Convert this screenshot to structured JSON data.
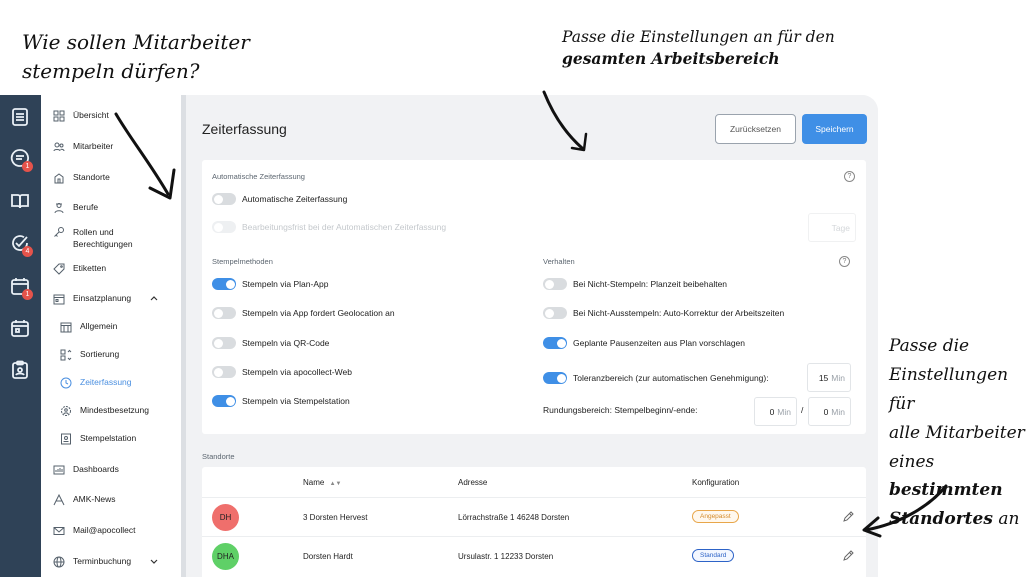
{
  "annotations": {
    "left_line1": "Wie sollen Mitarbeiter",
    "left_line2": "stempeln dürfen?",
    "top_line1": "Passe die Einstellungen an für den",
    "top_line2": "gesamten Arbeitsbereich",
    "right_line1": "Passe die",
    "right_line2": "Einstellungen für",
    "right_line3": "alle Mitarbeiter",
    "right_line4_a": "eines ",
    "right_line4_b": "bestimmten",
    "right_line5_a": "Standortes",
    "right_line5_b": " an"
  },
  "rail": {
    "badges": [
      "1",
      "4",
      "1"
    ]
  },
  "sidebar": {
    "items": [
      {
        "label": "Übersicht",
        "icon": "grid-icon"
      },
      {
        "label": "Mitarbeiter",
        "icon": "users-icon"
      },
      {
        "label": "Standorte",
        "icon": "house-icon"
      },
      {
        "label": "Berufe",
        "icon": "worker-icon"
      },
      {
        "label": "Rollen und\nBerechtigungen",
        "icon": "key-icon"
      },
      {
        "label": "Etiketten",
        "icon": "tag-icon"
      },
      {
        "label": "Einsatzplanung",
        "icon": "calendar-icon"
      },
      {
        "label": "Allgemein",
        "icon": "calendar-grid-icon"
      },
      {
        "label": "Sortierung",
        "icon": "sort-icon"
      },
      {
        "label": "Zeiterfassung",
        "icon": "clock-icon"
      },
      {
        "label": "Mindestbesetzung",
        "icon": "gear-people-icon"
      },
      {
        "label": "Stempelstation",
        "icon": "station-icon"
      },
      {
        "label": "Dashboards",
        "icon": "dashboard-icon"
      },
      {
        "label": "AMK-News",
        "icon": "news-icon"
      },
      {
        "label": "Mail@apocollect",
        "icon": "mail-icon"
      },
      {
        "label": "Terminbuchung",
        "icon": "globe-icon"
      }
    ]
  },
  "header": {
    "title": "Zeiterfassung",
    "reset_label": "Zurücksetzen",
    "save_label": "Speichern"
  },
  "auto": {
    "section_title": "Automatische Zeiterfassung",
    "toggle_label": "Automatische Zeiterfassung",
    "deadline_label": "Bearbeitungsfrist bei der Automatischen Zeiterfassung",
    "deadline_unit": "Tage"
  },
  "stempelmethoden": {
    "section_title": "Stempelmethoden",
    "items": [
      {
        "label": "Stempeln via Plan-App",
        "on": true
      },
      {
        "label": "Stempeln via App fordert Geolocation an",
        "on": false
      },
      {
        "label": "Stempeln via QR-Code",
        "on": false
      },
      {
        "label": "Stempeln via apocollect-Web",
        "on": false
      },
      {
        "label": "Stempeln via Stempelstation",
        "on": true
      }
    ]
  },
  "verhalten": {
    "section_title": "Verhalten",
    "items": [
      {
        "label": "Bei Nicht-Stempeln: Planzeit beibehalten",
        "on": false
      },
      {
        "label": "Bei Nicht-Ausstempeln: Auto-Korrektur der Arbeitszeiten",
        "on": false
      },
      {
        "label": "Geplante Pausenzeiten aus Plan vorschlagen",
        "on": true
      },
      {
        "label": "Toleranzbereich (zur automatischen Genehmigung):",
        "on": true
      }
    ],
    "tolerance_value": "15",
    "tolerance_unit": "Min",
    "rounding_label": "Rundungsbereich: Stempelbeginn/-ende:",
    "rounding_start": "0",
    "rounding_end": "0",
    "rounding_unit": "Min",
    "rounding_sep": "/"
  },
  "standorte": {
    "section_title": "Standorte",
    "columns": [
      "Name",
      "Adresse",
      "Konfiguration"
    ],
    "sort_indicator": "▲▼",
    "rows": [
      {
        "initials": "DH",
        "name": "3 Dorsten Hervest",
        "address": "Lörrachstraße 1 46248 Dorsten",
        "config": "Angepasst"
      },
      {
        "initials": "DHA",
        "name": "Dorsten Hardt",
        "address": "Ursulastr. 1 12233 Dorsten",
        "config": "Standard"
      }
    ]
  },
  "colors": {
    "rail": "#2f4257",
    "accent": "#3f8fe6",
    "avatar_dh": "#ef6f6c",
    "avatar_dha": "#5fd067",
    "badge_custom": "#e8a64a",
    "badge_standard": "#2d63c7"
  }
}
